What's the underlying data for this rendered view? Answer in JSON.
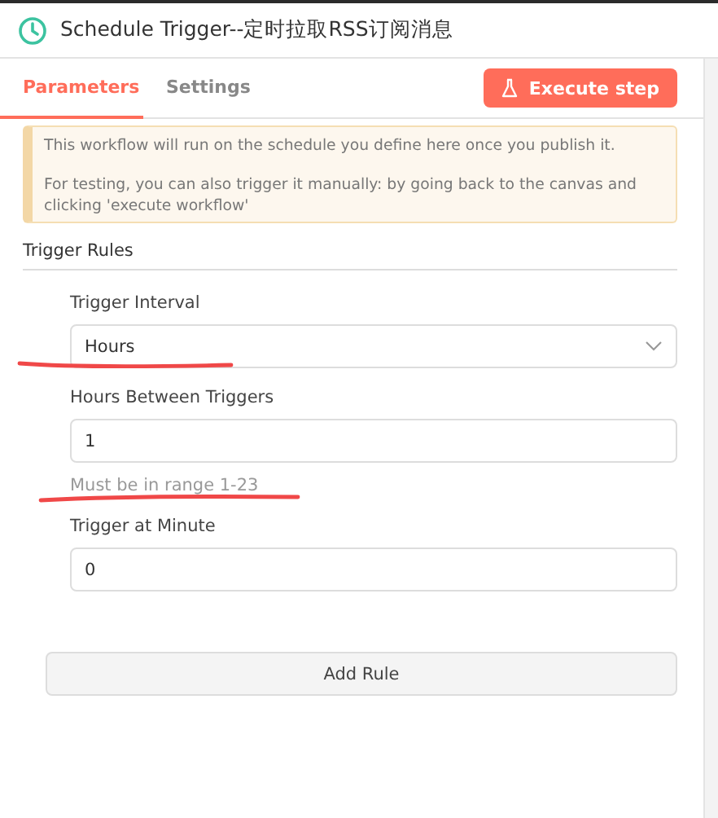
{
  "header": {
    "title": "Schedule Trigger--定时拉取RSS订阅消息"
  },
  "tabs": [
    {
      "label": "Parameters",
      "selected": true
    },
    {
      "label": "Settings",
      "selected": false
    }
  ],
  "execute_button": "Execute step",
  "notice": {
    "paragraphs": [
      "This workflow will run on the schedule you define here once you publish it.",
      "For testing, you can also trigger it manually: by going back to the canvas and clicking 'execute workflow'"
    ]
  },
  "section_title": "Trigger Rules",
  "fields": [
    {
      "kind": "select",
      "label": "Trigger Interval",
      "value": "Hours"
    },
    {
      "kind": "input",
      "label": "Hours Between Triggers",
      "value": "1",
      "hint": "Must be in range 1-23"
    },
    {
      "kind": "input",
      "label": "Trigger at Minute",
      "value": "0"
    }
  ],
  "add_button": "Add Rule"
}
